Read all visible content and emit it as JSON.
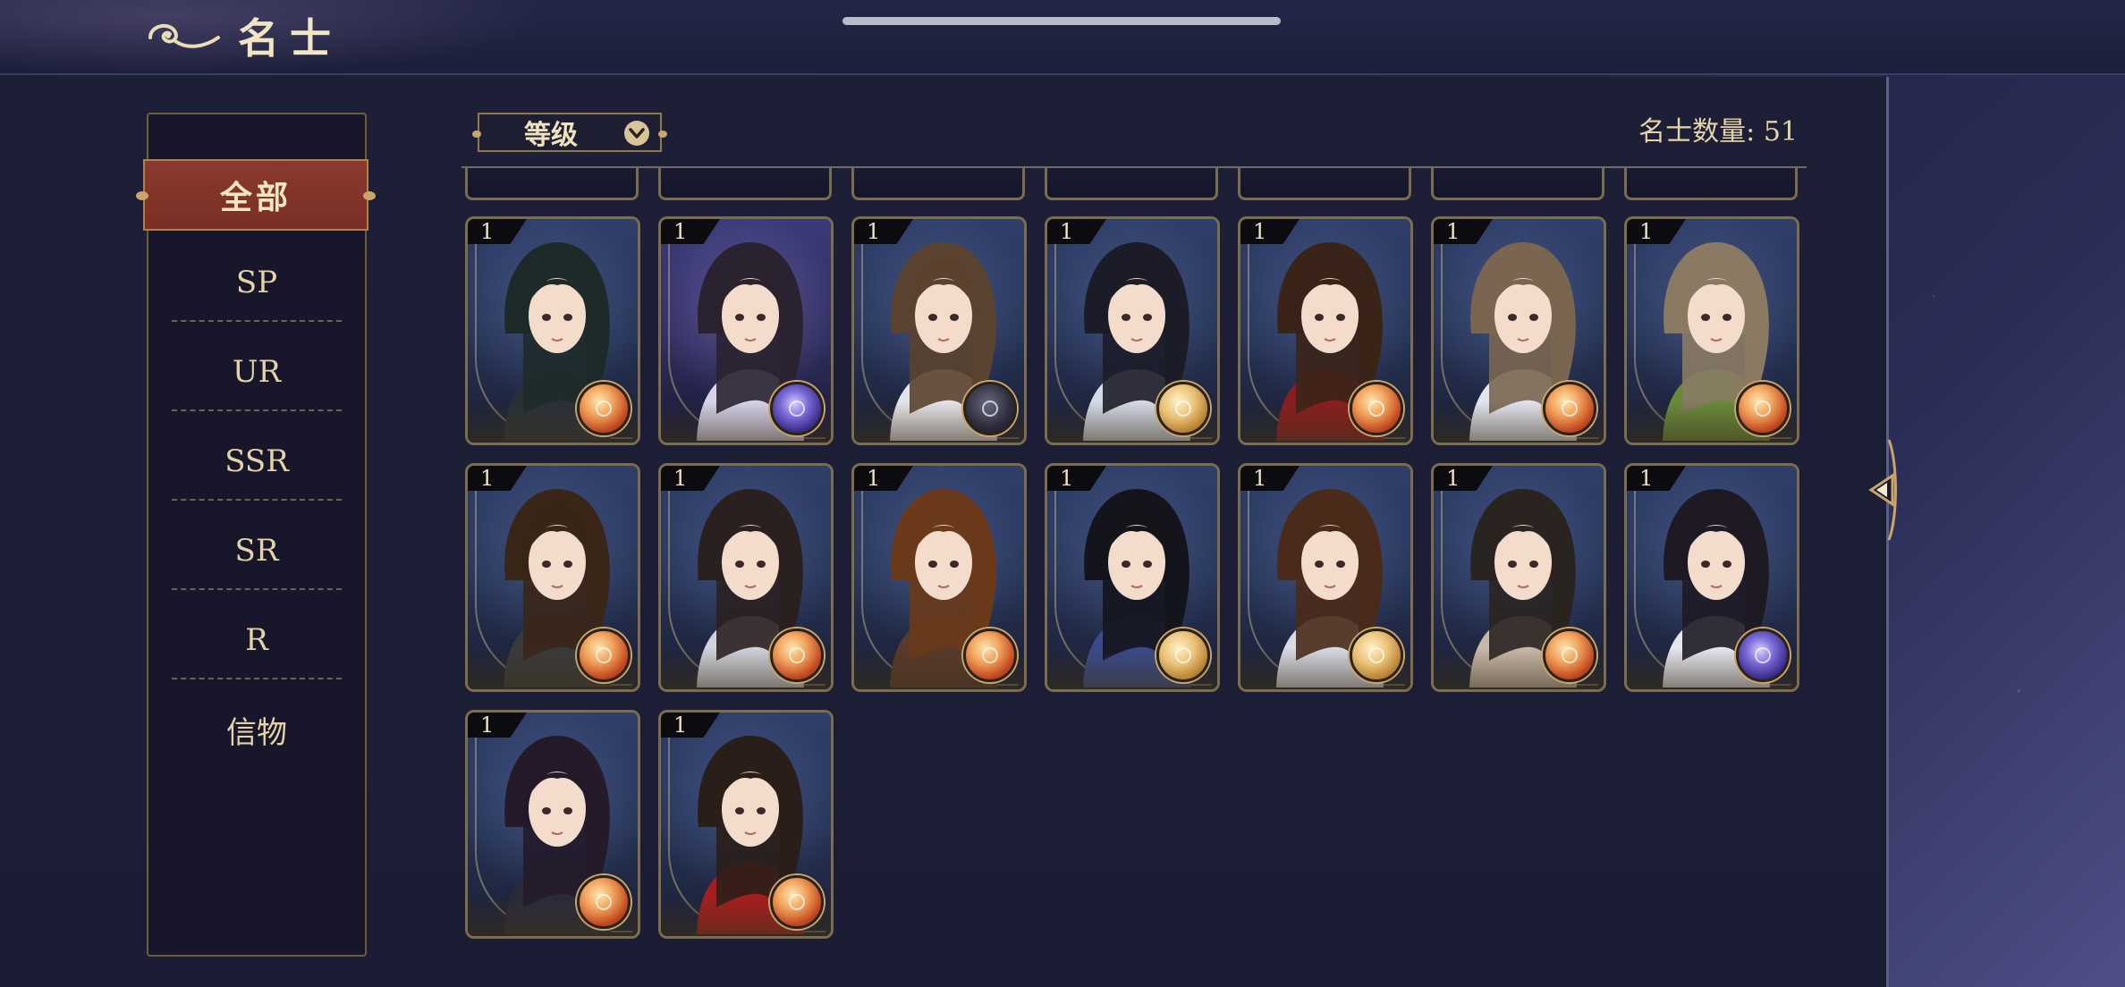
{
  "header": {
    "title": "名士"
  },
  "sort": {
    "label": "等级"
  },
  "count": {
    "label": "名士数量: 51"
  },
  "categories": {
    "active": "全部",
    "items": [
      "SP",
      "UR",
      "SSR",
      "SR",
      "R",
      "信物"
    ]
  },
  "cards": [
    {
      "level": "1",
      "orb": "fire",
      "bg": "blue",
      "hair": "#1e2a2a",
      "outfit": "#2a3038"
    },
    {
      "level": "1",
      "orb": "purple",
      "bg": "purple",
      "hair": "#2a2230",
      "outfit": "#d6d3ea"
    },
    {
      "level": "1",
      "orb": "dark",
      "bg": "blue",
      "hair": "#5a4330",
      "outfit": "#e6e4ea"
    },
    {
      "level": "1",
      "orb": "gold",
      "bg": "blue",
      "hair": "#1c1c28",
      "outfit": "#d4dae6"
    },
    {
      "level": "1",
      "orb": "fire",
      "bg": "blue",
      "hair": "#3a2418",
      "outfit": "#8a1e1e"
    },
    {
      "level": "1",
      "orb": "fire",
      "bg": "blue",
      "hair": "#7a6650",
      "outfit": "#e2e4f0"
    },
    {
      "level": "1",
      "orb": "fire",
      "bg": "blue",
      "hair": "#8a7a64",
      "outfit": "#6a8a3a"
    },
    {
      "level": "1",
      "orb": "fire",
      "bg": "blue",
      "hair": "#3a2618",
      "outfit": "#3a3a3a"
    },
    {
      "level": "1",
      "orb": "fire",
      "bg": "blue",
      "hair": "#2a2020",
      "outfit": "#d0d2dc"
    },
    {
      "level": "1",
      "orb": "fire",
      "bg": "blue",
      "hair": "#6a3a1a",
      "outfit": "#5a3a2a"
    },
    {
      "level": "1",
      "orb": "gold",
      "bg": "blue",
      "hair": "#14141c",
      "outfit": "#3a4a8a"
    },
    {
      "level": "1",
      "orb": "gold",
      "bg": "blue",
      "hair": "#4a2a1a",
      "outfit": "#d8dae4"
    },
    {
      "level": "1",
      "orb": "fire",
      "bg": "blue",
      "hair": "#2a2420",
      "outfit": "#c8b8a8"
    },
    {
      "level": "1",
      "orb": "purple",
      "bg": "blue",
      "hair": "#1e1a24",
      "outfit": "#e6e6f0"
    },
    {
      "level": "1",
      "orb": "fire",
      "bg": "blue",
      "hair": "#241a2a",
      "outfit": "#2a2a3a"
    },
    {
      "level": "1",
      "orb": "fire",
      "bg": "blue",
      "hair": "#2a1e18",
      "outfit": "#a81e1e"
    }
  ]
}
